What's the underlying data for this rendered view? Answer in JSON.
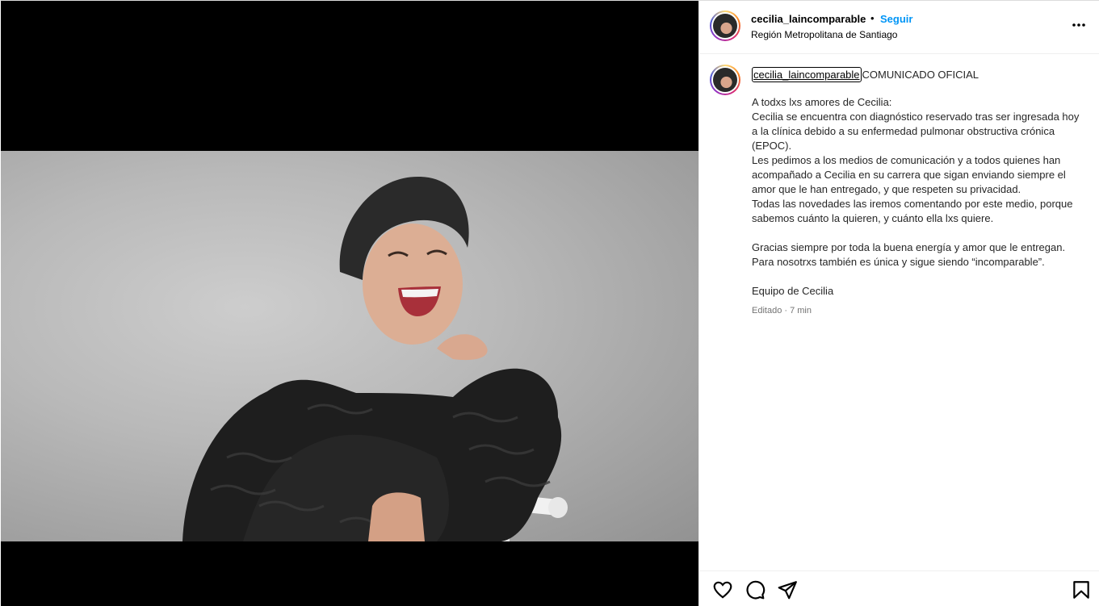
{
  "post": {
    "username": "cecilia_laincomparable",
    "separator": "•",
    "follow_label": "Seguir",
    "location": "Región Metropolitana de Santiago",
    "more_icon": "more-horizontal-icon"
  },
  "caption": {
    "username": "cecilia_laincomparable",
    "first_line": "COMUNICADO OFICIAL",
    "body": "A todxs lxs amores de Cecilia:\nCecilia se encuentra con diagnóstico reservado tras ser ingresada hoy a la clínica debido a su enfermedad pulmonar obstructiva crónica (EPOC).\nLes pedimos a los medios de comunicación y a todos quienes han acompañado a Cecilia en su carrera que sigan enviando siempre el amor que le han entregado, y que respeten su privacidad.\nTodas las novedades las iremos comentando por este medio, porque sabemos cuánto la quieren, y cuánto ella lxs quiere.\n\nGracias siempre por toda la buena energía y amor que le entregan.\nPara nosotrxs también es única y sigue siendo “incomparable”.\n\nEquipo de Cecilia",
    "meta": "Editado · 7 min"
  },
  "actions": {
    "icons": [
      "heart-icon",
      "comment-icon",
      "share-icon",
      "bookmark-icon"
    ]
  },
  "colors": {
    "link": "#0095f6",
    "text": "#262626",
    "muted": "#737373"
  }
}
